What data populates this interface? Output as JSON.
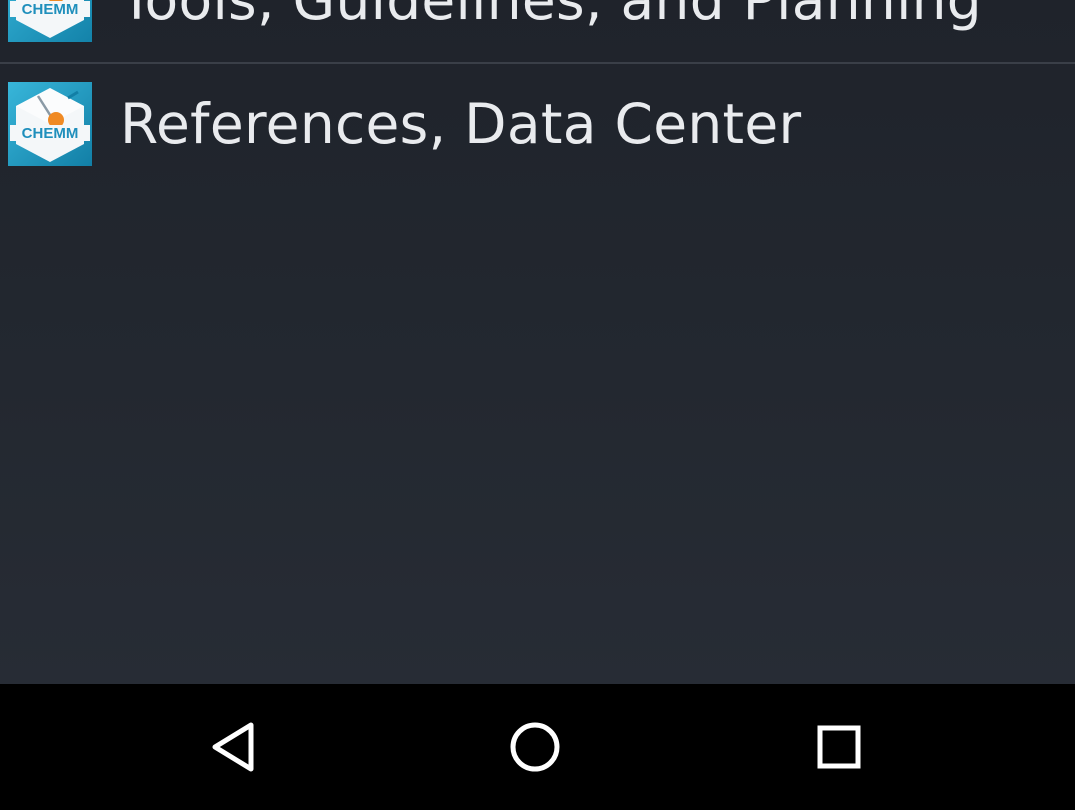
{
  "list": {
    "items": [
      {
        "label": "Tools, Guidelines, and Planning",
        "icon": "chemm-app-icon",
        "icon_text": "CHEMM"
      },
      {
        "label": "References, Data Center",
        "icon": "chemm-app-icon",
        "icon_text": "CHEMM"
      }
    ]
  },
  "navbar": {
    "back": "back-triangle-icon",
    "home": "home-circle-icon",
    "recent": "recent-apps-square-icon"
  },
  "colors": {
    "background": "#23272f",
    "text": "#e9ebee",
    "icon_teal": "#1f9fc6",
    "icon_orange": "#f08a24",
    "navbar": "#000000"
  }
}
